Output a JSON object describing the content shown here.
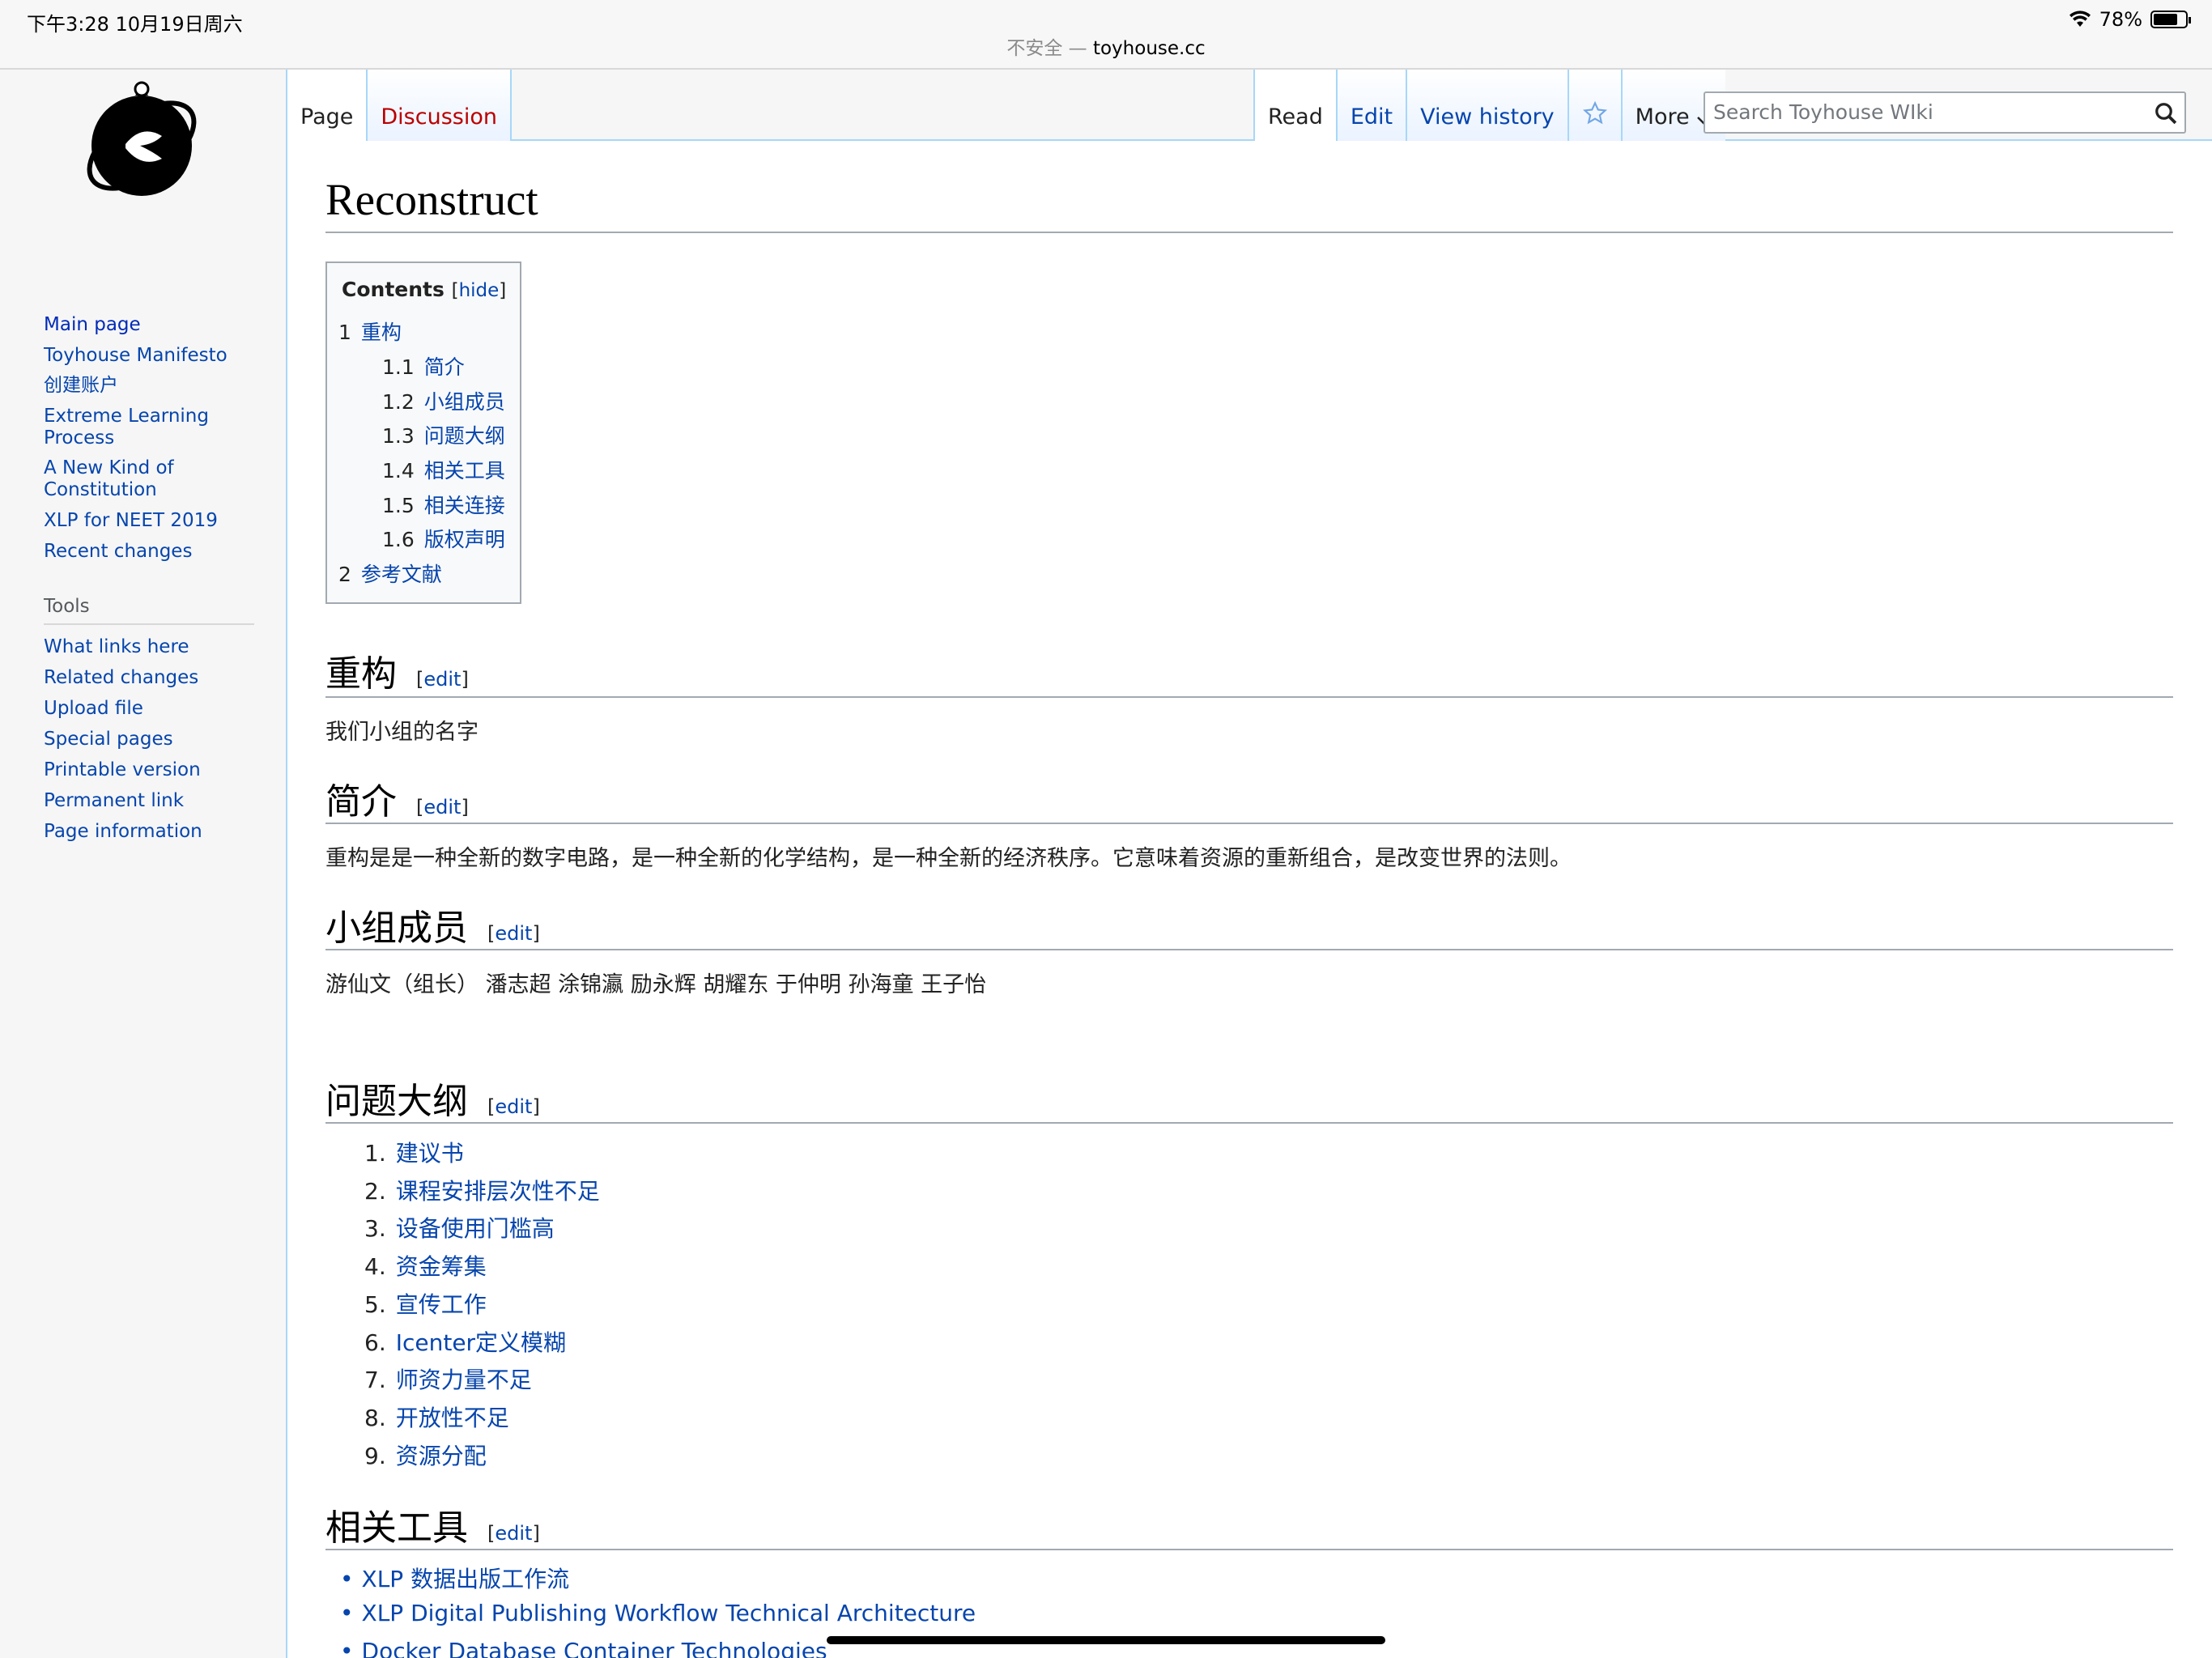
{
  "status_bar": {
    "time": "下午3:28   10月19日周六",
    "battery": "78%",
    "battery_level": 0.78
  },
  "url_bar": {
    "insecure_label": "不安全 —",
    "domain": "toyhouse.cc"
  },
  "sidebar": {
    "nav": [
      "Main page",
      "Toyhouse Manifesto",
      "创建账户",
      "Extreme Learning Process",
      "A New Kind of Constitution",
      "XLP for NEET 2019",
      "Recent changes"
    ],
    "tools_heading": "Tools",
    "tools": [
      "What links here",
      "Related changes",
      "Upload file",
      "Special pages",
      "Printable version",
      "Permanent link",
      "Page information"
    ]
  },
  "tabs": {
    "page": "Page",
    "discussion": "Discussion",
    "read": "Read",
    "edit": "Edit",
    "view_history": "View history",
    "more": "More"
  },
  "search": {
    "placeholder": "Search Toyhouse WIki"
  },
  "page": {
    "title": "Reconstruct",
    "toc": {
      "title": "Contents",
      "hide_open": "[",
      "hide": "hide",
      "hide_close": "]",
      "items": [
        {
          "num": "1",
          "text": "重构"
        },
        {
          "num": "1.1",
          "text": "简介"
        },
        {
          "num": "1.2",
          "text": "小组成员"
        },
        {
          "num": "1.3",
          "text": "问题大纲"
        },
        {
          "num": "1.4",
          "text": "相关工具"
        },
        {
          "num": "1.5",
          "text": "相关连接"
        },
        {
          "num": "1.6",
          "text": "版权声明"
        },
        {
          "num": "2",
          "text": "参考文献"
        }
      ]
    },
    "edit_open": "[",
    "edit_label": "edit",
    "edit_close": "]",
    "sections": {
      "s1": {
        "title": "重构",
        "text": "我们小组的名字"
      },
      "s2": {
        "title": "简介",
        "text": "重构是是一种全新的数字电路，是一种全新的化学结构，是一种全新的经济秩序。它意味着资源的重新组合，是改变世界的法则。"
      },
      "s3": {
        "title": "小组成员",
        "text": "游仙文（组长） 潘志超 涂锦瀛 励永辉 胡耀东 于仲明 孙海童 王子怡"
      },
      "s4": {
        "title": "问题大纲",
        "items": [
          "建议书",
          "课程安排层次性不足",
          "设备使用门槛高",
          "资金筹集",
          "宣传工作",
          "Icenter定义模糊",
          "师资力量不足",
          "开放性不足",
          "资源分配"
        ]
      },
      "s5": {
        "title": "相关工具",
        "items": [
          "XLP 数据出版工作流",
          "XLP Digital Publishing Workflow Technical Architecture",
          "Docker Database Container Technologies"
        ]
      }
    }
  }
}
